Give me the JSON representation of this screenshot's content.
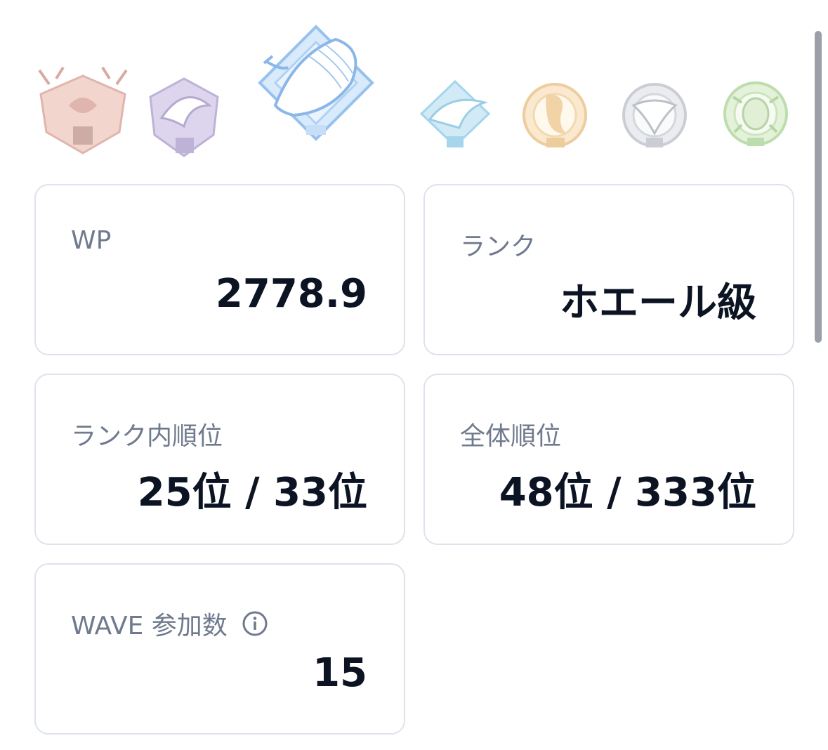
{
  "badges": [
    {
      "icon": "crab-badge-icon",
      "color": "#e4a99c"
    },
    {
      "icon": "orca-badge-icon",
      "color": "#b9a6d8"
    },
    {
      "icon": "whale-badge-icon",
      "color": "#a6cdf3",
      "selected": true
    },
    {
      "icon": "shark-badge-icon",
      "color": "#9fd3ec"
    },
    {
      "icon": "seahorse-badge-icon",
      "color": "#f0c98e"
    },
    {
      "icon": "manta-badge-icon",
      "color": "#c6cbd3"
    },
    {
      "icon": "turtle-badge-icon",
      "color": "#b8dba3"
    }
  ],
  "stats": {
    "wp": {
      "label": "WP",
      "value": "2778.9"
    },
    "rank": {
      "label": "ランク",
      "value": "ホエール級"
    },
    "rank_position": {
      "label": "ランク内順位",
      "value": "25位 / 33位"
    },
    "overall_position": {
      "label": "全体順位",
      "value": "48位 / 333位"
    },
    "wave_count": {
      "label": "WAVE 参加数",
      "value": "15"
    }
  },
  "colors": {
    "label": "#6f7a8e",
    "value": "#0c1424",
    "card_border": "#dde3ec"
  }
}
